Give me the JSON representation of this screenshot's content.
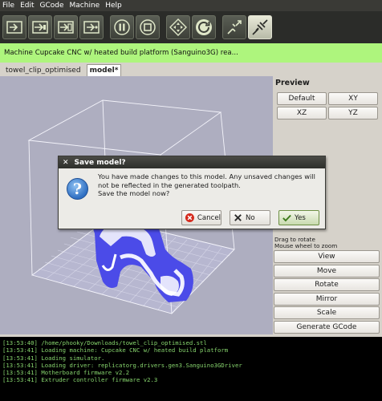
{
  "menu": [
    "File",
    "Edit",
    "GCode",
    "Machine",
    "Help"
  ],
  "toolbar": {
    "icons": [
      "build-icon",
      "upload-icon",
      "build-to-file-icon",
      "simulate-icon",
      "pause-icon",
      "stop-icon",
      "jog-control-icon",
      "reset-icon",
      "disconnect-icon",
      "connect-icon"
    ]
  },
  "status": {
    "text": "Machine Cupcake CNC w/ heated build platform (Sanguino3G) rea..."
  },
  "tabs": [
    {
      "label": "towel_clip_optimised"
    },
    {
      "label": "model*",
      "selected": true
    }
  ],
  "preview": {
    "title": "Preview",
    "buttons": [
      "Default",
      "XY",
      "XZ",
      "YZ"
    ]
  },
  "hints": {
    "line1": "Drag to rotate",
    "line2": "Mouse wheel to zoom"
  },
  "actions": [
    "View",
    "Move",
    "Rotate",
    "Mirror",
    "Scale",
    "Generate GCode"
  ],
  "console": [
    "[13:53:40] /home/phooky/Downloads/towel_clip_optimised.stl",
    "[13:53:41] Loading machine: Cupcake CNC w/ heated build platform",
    "[13:53:41] Loading simulator.",
    "[13:53:41] Loading driver: replicatorg.drivers.gen3.Sanguino3GDriver",
    "[13:53:41] Motherboard firmware v2.2",
    "[13:53:41] Extruder controller firmware v2.3"
  ],
  "dialog": {
    "title": "Save model?",
    "message_line1": "You have made changes to this model.  Any unsaved changes will",
    "message_line2": "not be reflected in the generated toolpath.",
    "message_line3": "Save the model now?",
    "cancel_label": "Cancel",
    "no_label": "No",
    "yes_label": "Yes"
  }
}
